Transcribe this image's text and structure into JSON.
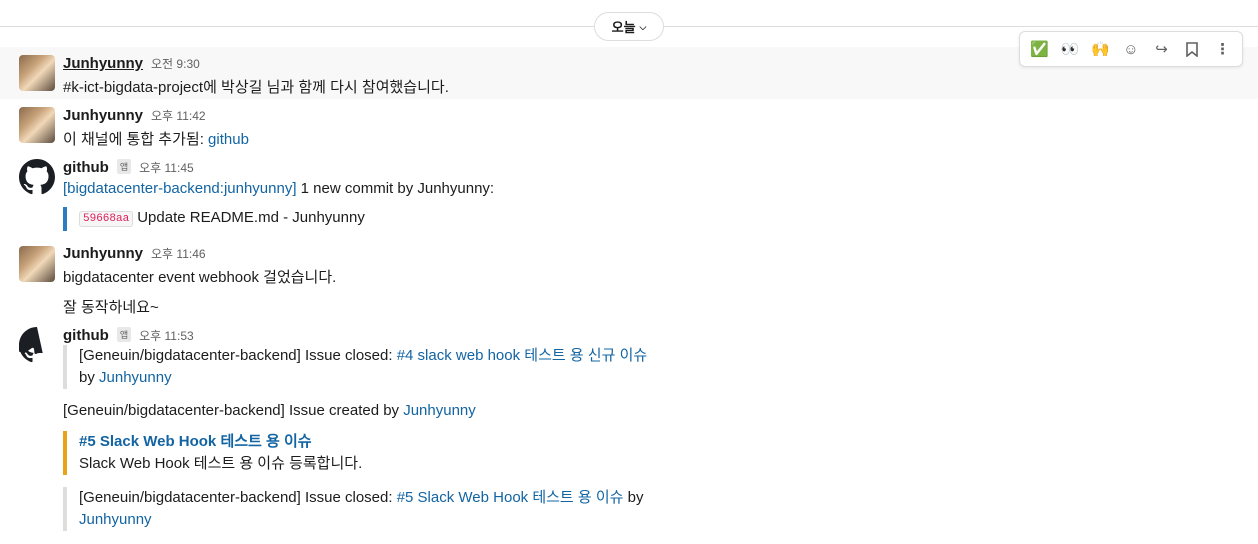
{
  "date_divider": {
    "label": "오늘"
  },
  "toolbar": {
    "icons": [
      "check-mark-emoji",
      "eyes-emoji",
      "raised-hands-emoji",
      "add-reaction-icon",
      "share-icon",
      "bookmark-icon",
      "more-icon"
    ],
    "glyphs": {
      "check": "✅",
      "eyes": "👀",
      "hands": "🙌",
      "reaction": "☺",
      "share": "↪",
      "bookmark": "🔖",
      "more": "⋮"
    }
  },
  "messages": [
    {
      "author": "Junhyunny",
      "time": "오전 9:30",
      "channel_link": "#k-ict-bigdata-project",
      "text": "에 박상길 님과 함께 다시 참여했습니다."
    },
    {
      "author": "Junhyunny",
      "time": "오후 11:42",
      "text": "이 채널에 통합 추가됨: ",
      "link": "github"
    },
    {
      "author": "github",
      "app_badge": "앱",
      "time": "오후 11:45",
      "branch_link": "[bigdatacenter-backend:junhyunny]",
      "text": " 1 new commit by Junhyunny:",
      "commit": {
        "hash": "59668aa",
        "message": "Update README.md - Junhyunny"
      }
    },
    {
      "author": "Junhyunny",
      "time": "오후 11:46",
      "lines": [
        "bigdatacenter event webhook 걸었습니다.",
        "잘 동작하네요~"
      ]
    },
    {
      "author": "github",
      "app_badge": "앱",
      "time": "오후 11:53",
      "issue_closed_1": {
        "prefix": "[Geneuin/bigdatacenter-backend] Issue closed: ",
        "issue_link": "#4 slack web hook 테스트 용 신규 이슈",
        "by": "by ",
        "user": "Junhyunny"
      },
      "issue_created": {
        "prefix": "[Geneuin/bigdatacenter-backend] Issue created by ",
        "user": "Junhyunny",
        "title_link": "#5 Slack Web Hook 테스트 용 이슈",
        "body": "Slack Web Hook 테스트 용 이슈 등록합니다."
      },
      "issue_closed_2": {
        "prefix": "[Geneuin/bigdatacenter-backend] Issue closed: ",
        "issue_link": "#5 Slack Web Hook 테스트 용 이슈",
        "by": " by",
        "user": "Junhyunny"
      }
    }
  ]
}
